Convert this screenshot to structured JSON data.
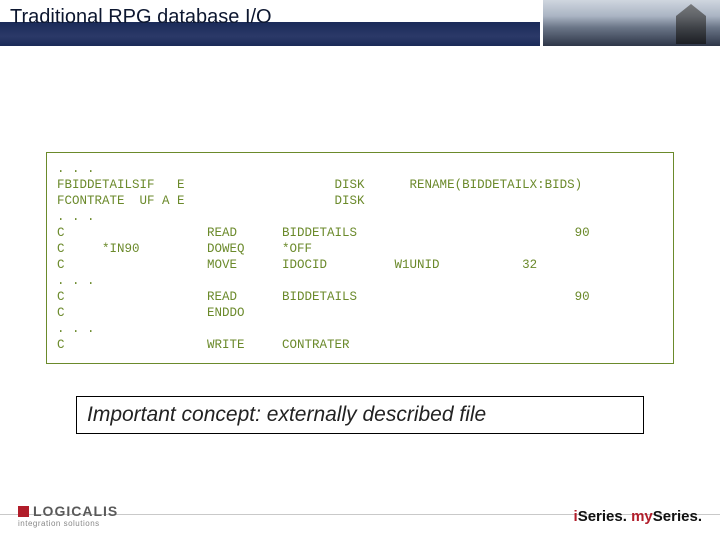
{
  "title": "Traditional RPG database I/O",
  "code": ". . .\nFBIDDETAILSIF   E                    DISK      RENAME(BIDDETAILX:BIDS)\nFCONTRATE  UF A E                    DISK\n. . .\nC                   READ      BIDDETAILS                             90\nC     *IN90         DOWEQ     *OFF\nC                   MOVE      IDOCID         W1UNID           32\n. . .\nC                   READ      BIDDETAILS                             90\nC                   ENDDO\n. . .\nC                   WRITE     CONTRATER",
  "concept": "Important concept: externally described file",
  "footer": {
    "brand": "LOGICALIS",
    "tagline": "integration solutions",
    "right_prefix_i1": "i",
    "right_series": "Series.",
    "right_my": " my",
    "right_series2": "Series."
  }
}
